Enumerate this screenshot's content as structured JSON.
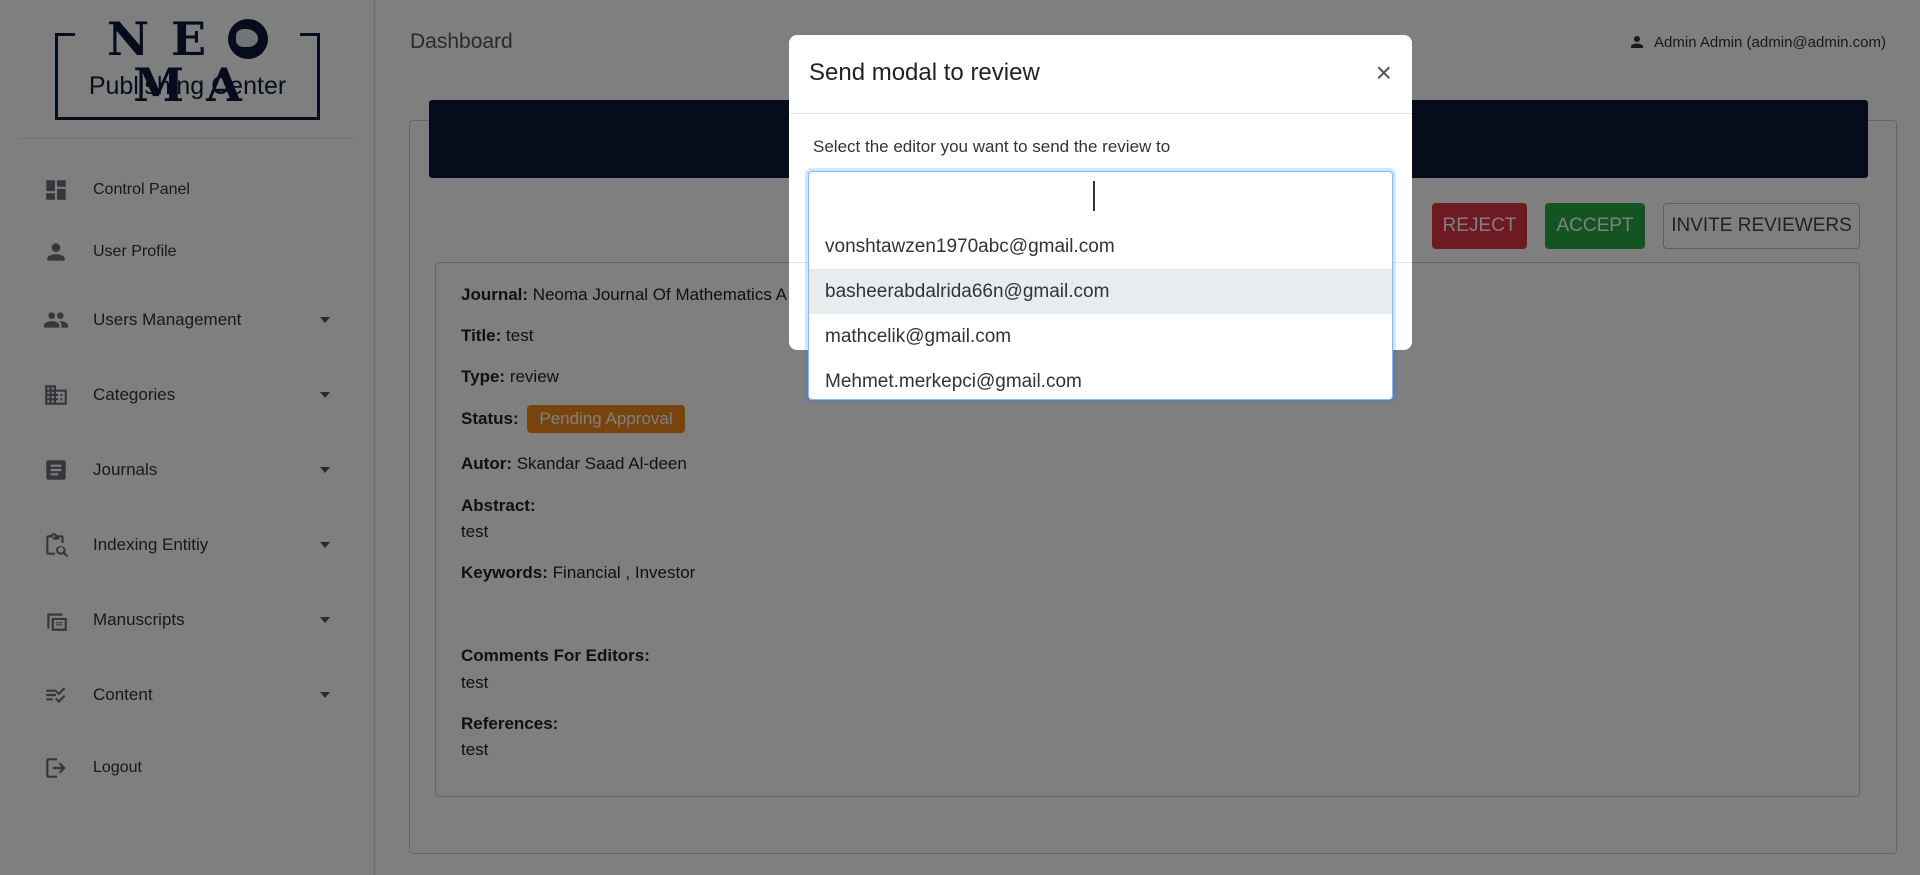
{
  "logo": {
    "title": "NEOMA",
    "subtitle": "Publishing Center"
  },
  "sidebar": {
    "items": [
      {
        "label": "Control Panel",
        "icon": "dashboard-icon",
        "dropdown": false
      },
      {
        "label": "User Profile",
        "icon": "person-icon",
        "dropdown": false
      },
      {
        "label": "Users Management",
        "icon": "people-icon",
        "dropdown": true
      },
      {
        "label": "Categories",
        "icon": "building-icon",
        "dropdown": true
      },
      {
        "label": "Journals",
        "icon": "article-icon",
        "dropdown": true
      },
      {
        "label": "Indexing Entitiy",
        "icon": "clipboard-search-icon",
        "dropdown": true
      },
      {
        "label": "Manuscripts",
        "icon": "manuscript-icon",
        "dropdown": true
      },
      {
        "label": "Content",
        "icon": "checklist-icon",
        "dropdown": true
      },
      {
        "label": "Logout",
        "icon": "logout-icon",
        "dropdown": false
      }
    ]
  },
  "header": {
    "title": "Dashboard",
    "user": "Admin Admin (admin@admin.com)"
  },
  "actions": {
    "reject": "REJECT",
    "accept": "ACCEPT",
    "invite": "INVITE REVIEWERS"
  },
  "details": {
    "journal_label": "Journal:",
    "journal_value": "Neoma Journal Of Mathematics A",
    "title_label": "Title:",
    "title_value": "test",
    "type_label": "Type:",
    "type_value": "review",
    "status_label": "Status:",
    "status_value": "Pending Approval",
    "autor_label": "Autor:",
    "autor_value": "Skandar Saad Al-deen",
    "abstract_label": "Abstract:",
    "abstract_value": "test",
    "keywords_label": "Keywords:",
    "keywords_value": "Financial , Investor",
    "comments_label": "Comments For Editors:",
    "comments_value": "test",
    "references_label": "References:",
    "references_value": "test"
  },
  "modal": {
    "title": "Send modal to review",
    "close": "×",
    "label": "Select the editor you want to send the review to",
    "options": [
      "vonshtawzen1970abc@gmail.com",
      "basheerabdalrida66n@gmail.com",
      "mathcelik@gmail.com",
      "Mehmet.merkepci@gmail.com"
    ],
    "highlighted_index": 1
  },
  "colors": {
    "brand": "#0b1b3a",
    "reject": "#dc3545",
    "accept": "#28a745",
    "status": "#f0891a"
  }
}
